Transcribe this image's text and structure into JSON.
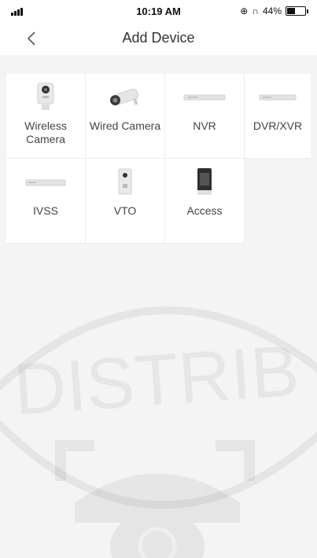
{
  "status": {
    "time": "10:19 AM",
    "battery": "44%",
    "battery_level": 0.44
  },
  "nav": {
    "title": "Add Device",
    "back_icon": "chevron-left-icon"
  },
  "devices": [
    {
      "label": "Wireless Camera",
      "icon": "wireless-camera-icon"
    },
    {
      "label": "Wired Camera",
      "icon": "bullet-camera-icon"
    },
    {
      "label": "NVR",
      "icon": "nvr-icon"
    },
    {
      "label": "DVR/XVR",
      "icon": "dvr-icon"
    },
    {
      "label": "IVSS",
      "icon": "ivss-icon"
    },
    {
      "label": "VTO",
      "icon": "vto-icon"
    },
    {
      "label": "Access",
      "icon": "access-control-icon"
    }
  ],
  "watermark": {
    "text": "DISTRIB"
  },
  "colors": {
    "background": "#f4f4f5",
    "card": "#ffffff",
    "text": "#444444",
    "divider": "#ececec"
  }
}
